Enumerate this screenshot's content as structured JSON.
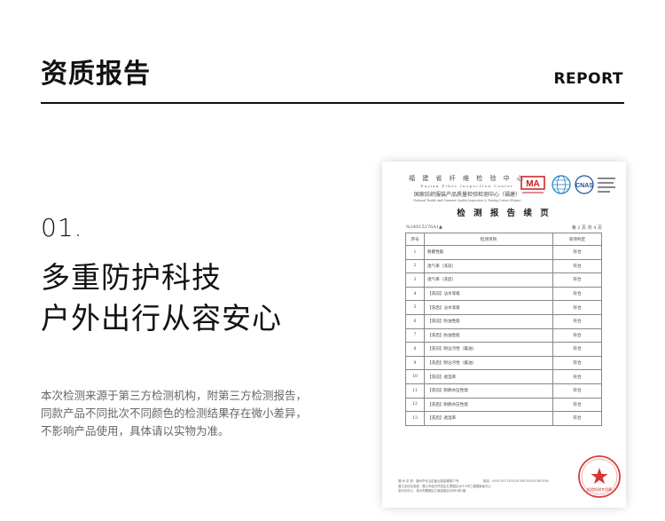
{
  "header": {
    "title": "资质报告",
    "label": "REPORT"
  },
  "section": {
    "number": "01.",
    "headline": [
      "多重防护科技",
      "户外出行从容安心"
    ],
    "description": [
      "本次检测来源于第三方检测机构，附第三方检测报告，",
      "同款产品不同批次不同颜色的检测结果存在微小差异，",
      "不影响产品使用，具体请以实物为准。"
    ]
  },
  "report_doc": {
    "org_cn": "福 建 省 纤 维 检 验 中 心",
    "org_en": "Fujian Fiber Inspection Center",
    "org_cn2": "国家纺织服装产品质量检验检测中心（福建）",
    "org_en2": "National Textile And Garment Quality Inspection & Testing Center (Fujian)",
    "logos": [
      "MA",
      "CNAS"
    ],
    "title": "检 测 报 告 续 页",
    "report_no": "№24015276A1▲",
    "page": "第 2 页 共 4 页",
    "columns": [
      "序号",
      "检测项目",
      "单项判定"
    ],
    "rows": [
      [
        "1",
        "耐磨性能",
        "符合"
      ],
      [
        "2",
        "透气率（洗前）",
        "符合"
      ],
      [
        "3",
        "透气率（洗后）",
        "符合"
      ],
      [
        "4",
        "【洗前】沾水等级",
        "符合"
      ],
      [
        "5",
        "【洗后】沾水等级",
        "符合"
      ],
      [
        "6",
        "【洗前】防油性能",
        "符合"
      ],
      [
        "7",
        "【洗后】防油性能",
        "符合"
      ],
      [
        "8",
        "【洗前】耐沾污性（酱油）",
        "符合"
      ],
      [
        "9",
        "【洗后】耐沾污性（酱油）",
        "符合"
      ],
      [
        "10",
        "【洗前】透湿率",
        "符合"
      ],
      [
        "11",
        "【洗前】耐静水压性能",
        "符合"
      ],
      [
        "12",
        "【洗后】耐静水压性能",
        "符合"
      ],
      [
        "13",
        "【洗后】透湿率",
        "符合"
      ]
    ],
    "footer": [
      "福 州 总 部：福州市仓山区盖山镇金港路17号　　　　　　　　电话：0591-83711002/87887055/87887056",
      "晋江化纺实验室：晋江市经济开发区五里园区ASU1号三楼国家级中心",
      "泉州分中心：泉州市鲤城区江南高新区44号3栋2楼"
    ],
    "stamp_text": "检验检测专用章"
  }
}
